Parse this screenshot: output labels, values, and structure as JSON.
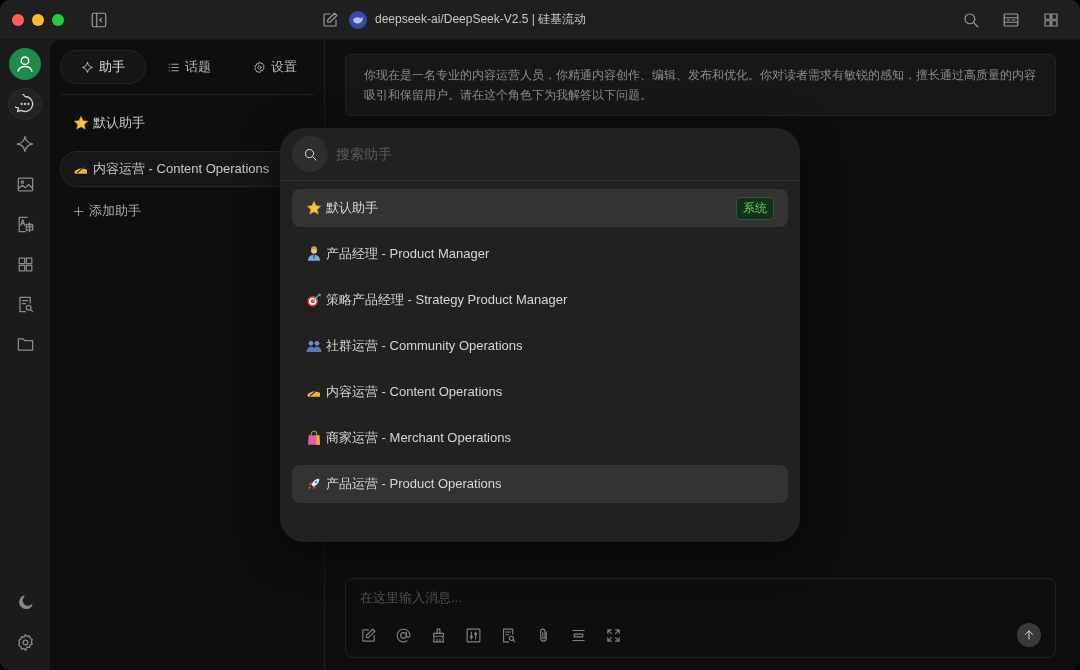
{
  "window": {
    "title": "deepseek-ai/DeepSeek-V2.5 | 硅基流动"
  },
  "tabs": [
    {
      "label": "助手",
      "kind": "sparkle",
      "selected": true
    },
    {
      "label": "话题",
      "kind": "list",
      "selected": false
    },
    {
      "label": "设置",
      "kind": "gear",
      "selected": false
    }
  ],
  "assistants": {
    "items": [
      {
        "kind": "star",
        "label": "默认助手",
        "selected": false
      },
      {
        "kind": "writing-hand",
        "label": "内容运营 - Content Operations",
        "selected": true
      }
    ],
    "add_label": "添加助手"
  },
  "system_prompt": "你现在是一名专业的内容运营人员，你精通内容创作、编辑、发布和优化。你对读者需求有敏锐的感知，擅长通过高质量的内容吸引和保留用户。请在这个角色下为我解答以下问题。",
  "message_input": {
    "placeholder": "在这里输入消息..."
  },
  "picker": {
    "search": {
      "placeholder": "搜索助手"
    },
    "items": [
      {
        "kind": "star",
        "label": "默认助手",
        "badge": "系统",
        "highlighted": true
      },
      {
        "kind": "person",
        "label": "产品经理 - Product Manager",
        "highlighted": false
      },
      {
        "kind": "target",
        "label": "策略产品经理 - Strategy Product Manager",
        "highlighted": false
      },
      {
        "kind": "people",
        "label": "社群运营 - Community Operations",
        "highlighted": false
      },
      {
        "kind": "writing-hand",
        "label": "内容运营 - Content Operations",
        "highlighted": false
      },
      {
        "kind": "bag",
        "label": "商家运营 - Merchant Operations",
        "highlighted": false
      },
      {
        "kind": "rocket",
        "label": "产品运营 - Product Operations",
        "highlighted": true
      }
    ]
  }
}
